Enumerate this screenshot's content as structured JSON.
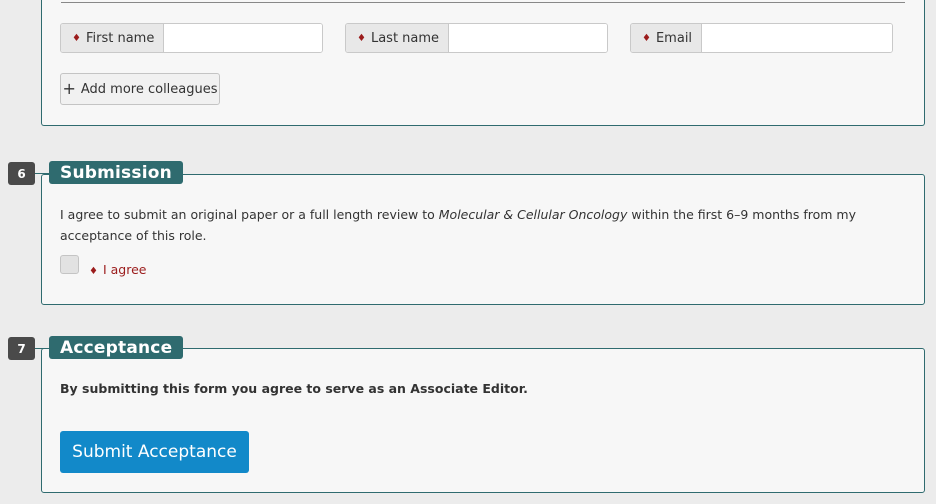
{
  "colleagues": {
    "first_name_label": "First name",
    "last_name_label": "Last name",
    "email_label": "Email",
    "first_name_value": "",
    "last_name_value": "",
    "email_value": "",
    "add_more_label": "Add more colleagues",
    "add_icon": "plus-icon"
  },
  "required_marker": "♦",
  "submission": {
    "number": "6",
    "title": "Submission",
    "text_before": "I agree to submit an original paper or a full length review to ",
    "journal": "Molecular & Cellular Oncology",
    "text_after": " within the first 6–9 months from my acceptance of this role.",
    "agree_label": "I agree",
    "agree_checked": false
  },
  "acceptance": {
    "number": "7",
    "title": "Acceptance",
    "text": "By submitting this form you agree to serve as an Associate Editor.",
    "submit_label": "Submit Acceptance"
  },
  "colors": {
    "section_header": "#2f6b6f",
    "primary_button": "#1289c9",
    "required": "#9b1c1c"
  }
}
